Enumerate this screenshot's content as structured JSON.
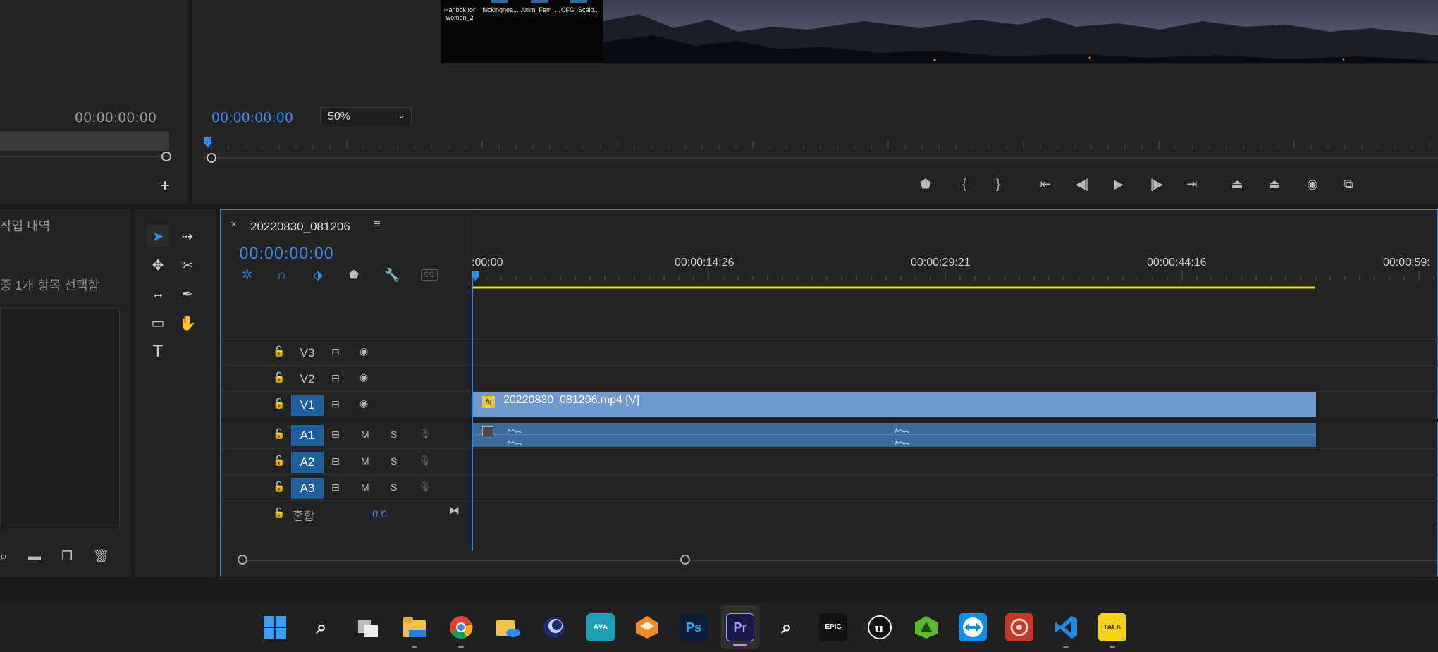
{
  "source": {
    "timecode": "00:00:00:00"
  },
  "program": {
    "timecode": "00:00:00:00",
    "zoom": "50%",
    "desktop_icons": [
      {
        "label": "Hanbok for women_2"
      },
      {
        "label": "fuckinghea..."
      },
      {
        "label": "Anim_Fem_..."
      },
      {
        "label": "CFG_Scalp..."
      }
    ],
    "controls": [
      "add-marker",
      "mark-in",
      "mark-out",
      "go-to-in",
      "step-back",
      "play",
      "step-forward",
      "go-to-out",
      "lift",
      "extract",
      "export-frame",
      "compare"
    ]
  },
  "history": {
    "title": "작업 내역",
    "status": "중 1개 항목 선택함"
  },
  "timeline": {
    "sequence_name": "20220830_081206",
    "timecode": "00:00:00:00",
    "ruler": [
      ":00:00",
      "00:00:14:26",
      "00:00:29:21",
      "00:00:44:16",
      "00:00:59:"
    ],
    "video_tracks": [
      {
        "name": "V3",
        "active": false
      },
      {
        "name": "V2",
        "active": false
      },
      {
        "name": "V1",
        "active": true
      }
    ],
    "audio_tracks": [
      {
        "name": "A1",
        "m": "M",
        "s": "S"
      },
      {
        "name": "A2",
        "m": "M",
        "s": "S"
      },
      {
        "name": "A3",
        "m": "M",
        "s": "S"
      }
    ],
    "mix": {
      "label": "혼합",
      "value": "0.0"
    },
    "clip": {
      "fx": "fx",
      "name": "20220830_081206.mp4 [V]"
    }
  },
  "taskbar": {
    "apps": [
      "windows-start",
      "search",
      "task-view",
      "file-explorer",
      "chrome",
      "onedrive",
      "cinema4d",
      "maya",
      "blender-sketch",
      "photoshop",
      "premiere",
      "mixed-reality",
      "epic-games",
      "unreal",
      "rizom",
      "teamviewer",
      "davinci",
      "vscode",
      "kakaotalk"
    ],
    "labels": {
      "maya": "AYA",
      "epic": "EPIC",
      "photoshop": "Ps",
      "premiere": "Pr",
      "talk": "TALK"
    }
  },
  "colors": {
    "accent": "#2d8ceb",
    "clip": "#6f9bd0",
    "workarea": "#e6e600"
  }
}
